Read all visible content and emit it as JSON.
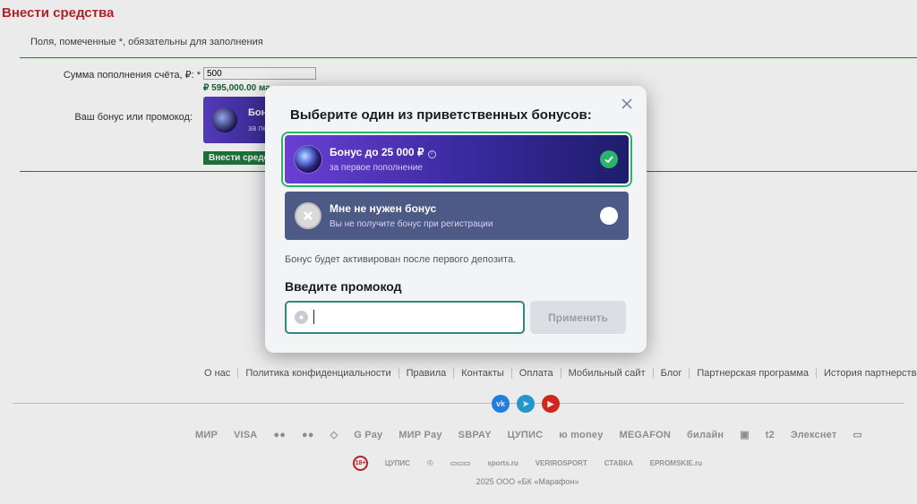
{
  "page": {
    "title": "Внести средства",
    "required_note": "Поля, помеченные *, обязательны для заполнения",
    "amount_label": "Сумма пополнения счёта, ₽: *",
    "amount_value": "500",
    "max_note": "₽ 595,000.00 ма",
    "bonus_label": "Ваш бонус или промокод:",
    "bonus_card_title": "Бону",
    "bonus_card_sub": "за пер",
    "submit_label": "Внести средс"
  },
  "modal": {
    "title": "Выберите один из приветственных бонусов:",
    "options": [
      {
        "title": "Бонус до 25 000 ₽",
        "subtitle": "за первое пополнение",
        "selected": true,
        "icon": "orb-icon"
      },
      {
        "title": "Мне не нужен бонус",
        "subtitle": "Вы не получите бонус при регистрации",
        "selected": false,
        "icon": "no-bonus-icon"
      }
    ],
    "note": "Бонус будет активирован после первого депозита.",
    "promo_title": "Введите промокод",
    "promo_value": "",
    "apply_label": "Применить"
  },
  "footer": {
    "links": [
      "О нас",
      "Политика конфиденциальности",
      "Правила",
      "Контакты",
      "Оплата",
      "Мобильный сайт",
      "Блог",
      "Партнерская программа",
      "История партнерства"
    ],
    "socials": [
      {
        "name": "vk",
        "text": "vk",
        "color": "#2787f5"
      },
      {
        "name": "telegram",
        "text": "➤",
        "color": "#2aa3dc"
      },
      {
        "name": "youtube",
        "text": "▶",
        "color": "#e02b20"
      }
    ],
    "payments": [
      "МИР",
      "VISA",
      "●●",
      "●●",
      "◇ ",
      "G Pay",
      "МИР Pay",
      "SBPAY",
      "ЦУПИС",
      "ю money",
      "MEGAFON",
      "билайн",
      "▣",
      "t2",
      "Элекснет",
      "▭"
    ],
    "partners": [
      "18+",
      "ЦУПИС",
      "☉",
      "▭▭▭",
      "sports.ru",
      "VERIROSPORT",
      "СТАВКА",
      "EPROMSKIE.ru"
    ],
    "copyright": "2025 ООО «БК «Марафон»"
  },
  "colors": {
    "title_red": "#c0262d",
    "accent_green": "#2bb36b",
    "rule_green": "#2e7d3a",
    "promo_border": "#2e8a7a"
  }
}
